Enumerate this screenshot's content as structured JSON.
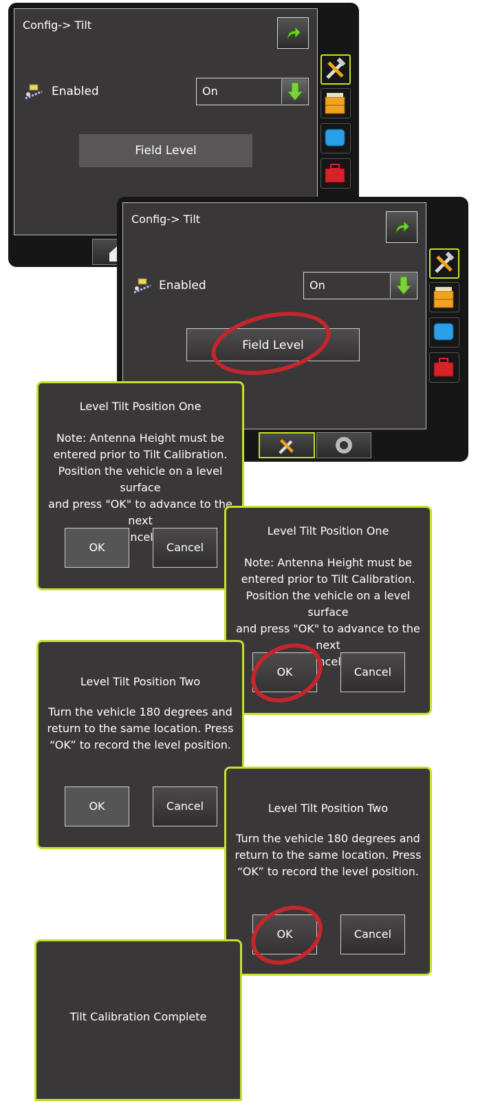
{
  "screen1": {
    "title": "Config-> Tilt",
    "enabled_label": "Enabled",
    "select_value": "On",
    "field_level_label": "Field Level"
  },
  "screen2": {
    "title": "Config-> Tilt",
    "enabled_label": "Enabled",
    "select_value": "On",
    "field_level_label": "Field Level"
  },
  "dialog1": {
    "title": "Level Tilt Position One",
    "lines": [
      "Note: Antenna Height must be",
      "entered prior to Tilt Calibration.",
      "Position the vehicle on a level surface",
      "and press \"OK\" to advance to the next",
      "step, or \"Cancel\" to cancel."
    ],
    "ok_label": "OK",
    "cancel_label": "Cancel"
  },
  "dialog2": {
    "title": "Level Tilt Position One",
    "lines": [
      "Note: Antenna Height must be",
      "entered prior to Tilt Calibration.",
      "Position the vehicle on a level surface",
      "and press \"OK\" to advance to the next",
      "step, or \"Cancel\" to cancel."
    ],
    "ok_label": "OK",
    "cancel_label": "Cancel"
  },
  "dialog3": {
    "title": "Level Tilt Position Two",
    "lines": [
      "Turn the vehicle 180 degrees and",
      "return to the same location.  Press",
      "“OK” to record the level position."
    ],
    "ok_label": "OK",
    "cancel_label": "Cancel"
  },
  "dialog4": {
    "title": "Level Tilt Position Two",
    "lines": [
      "Turn the vehicle 180 degrees and",
      "return to the same location.  Press",
      "“OK” to record the level position."
    ],
    "ok_label": "OK",
    "cancel_label": "Cancel"
  },
  "dialog5": {
    "message": "Tilt Calibration Complete"
  },
  "colors": {
    "accent": "#c4e22a",
    "highlight": "#c4262c",
    "panel": "#3a3739",
    "frame": "#161616"
  },
  "icons": [
    "back-arrow-icon",
    "tilt-sensor-icon",
    "down-arrow-icon",
    "tools-icon",
    "file-cabinet-icon",
    "display-icon",
    "toolbox-icon",
    "home-icon",
    "camera-icon"
  ]
}
